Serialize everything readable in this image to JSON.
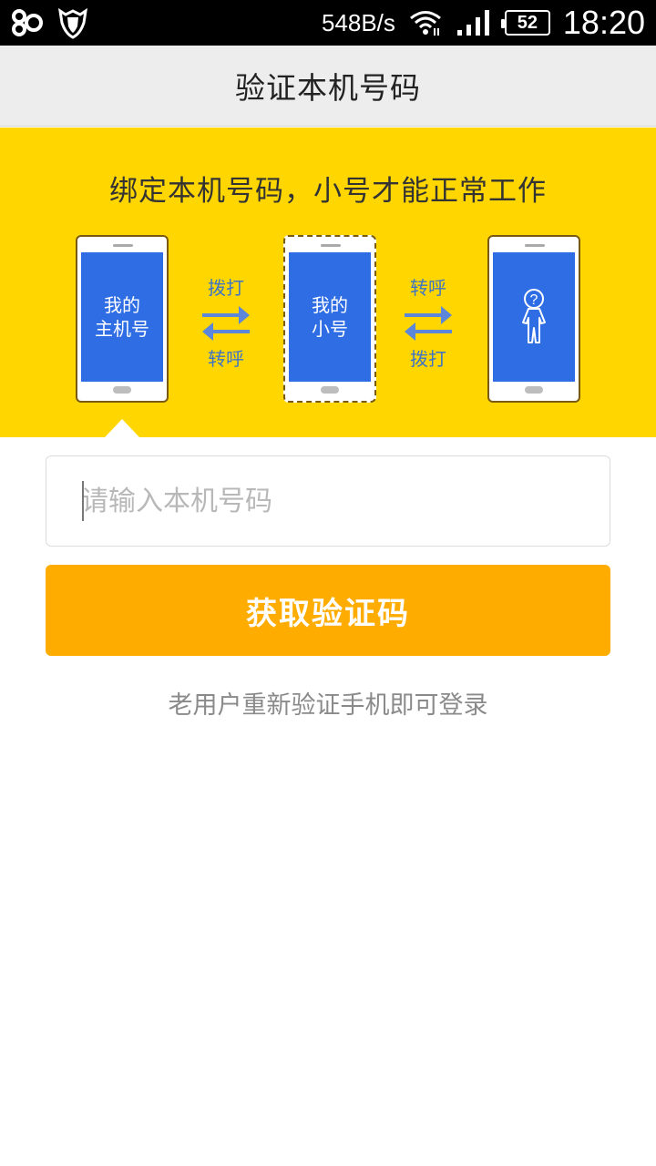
{
  "status_bar": {
    "left_icons": [
      "app-notification-icon",
      "shield-app-icon"
    ],
    "net_speed": "548B/s",
    "battery": "52",
    "time": "18:20"
  },
  "header": {
    "title": "验证本机号码"
  },
  "banner": {
    "headline": "绑定本机号码，小号才能正常工作",
    "phones": [
      {
        "line1": "我的",
        "line2": "主机号"
      },
      {
        "line1": "我的",
        "line2": "小号"
      },
      {
        "icon": "person-question-icon"
      }
    ],
    "exchanges": [
      {
        "top": "拨打",
        "bottom": "转呼"
      },
      {
        "top": "转呼",
        "bottom": "拨打"
      }
    ],
    "colors": {
      "background": "#ffd600",
      "screen": "#2f6de4",
      "arrow": "#5b86d9"
    }
  },
  "form": {
    "phone_input": {
      "placeholder": "请输入本机号码",
      "value": ""
    },
    "get_code_button": "获取验证码",
    "returning_user_link": "老用户重新验证手机即可登录",
    "colors": {
      "button": "#ffac00"
    }
  }
}
